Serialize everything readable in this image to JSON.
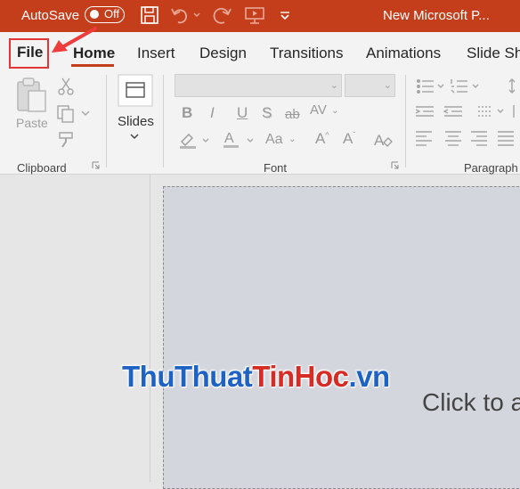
{
  "titlebar": {
    "autosave_label": "AutoSave",
    "autosave_state": "Off",
    "document_title": "New Microsoft P..."
  },
  "tabs": [
    {
      "label": "File",
      "selected": false,
      "highlighted": true
    },
    {
      "label": "Home",
      "selected": true
    },
    {
      "label": "Insert"
    },
    {
      "label": "Design"
    },
    {
      "label": "Transitions"
    },
    {
      "label": "Animations"
    },
    {
      "label": "Slide Sh"
    }
  ],
  "ribbon": {
    "clipboard": {
      "paste_label": "Paste",
      "group_label": "Clipboard"
    },
    "slides": {
      "new_slide_label": "Slides"
    },
    "font": {
      "group_label": "Font",
      "font_name_value": "",
      "font_size_value": ""
    },
    "paragraph": {
      "group_label": "Paragraph"
    }
  },
  "slide": {
    "title_placeholder": "Click to a"
  },
  "watermark": {
    "part1": "ThuThuat",
    "part2": "TinHoc",
    "part3": ".vn"
  },
  "colors": {
    "titlebar_bg": "#c43e1c",
    "ribbon_bg": "#f3f3f3",
    "slide_bg": "#d4d6dd",
    "highlight_red": "#e33535",
    "watermark_blue": "#1e63c4",
    "watermark_red": "#d62c26"
  },
  "icons": {
    "save": "save-icon",
    "undo": "undo-icon",
    "redo": "redo-icon",
    "present": "present-from-beginning-icon",
    "customize": "customize-quick-access-icon"
  }
}
